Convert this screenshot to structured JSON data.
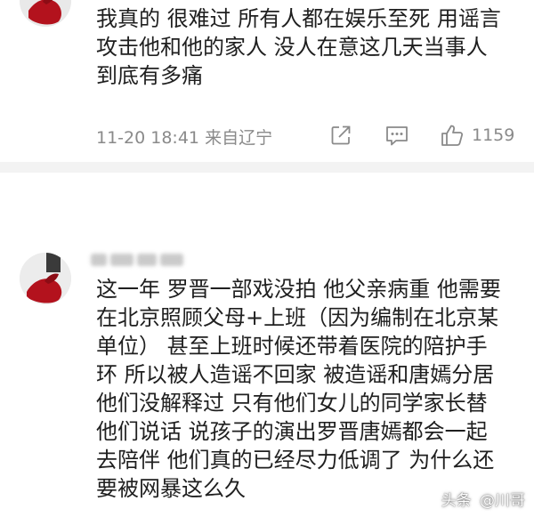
{
  "comments": [
    {
      "lines": [
        "我真的 很难过 所有人都在娱乐至死 用谣言",
        "攻击他和他的家人 没人在意这几天当事人",
        "到底有多痛"
      ],
      "time": "11-20 18:41",
      "location": "来自辽宁",
      "actions": {
        "share_icon": "share-icon",
        "comment_icon": "comment-icon",
        "like_icon": "thumbs-up-icon",
        "like_count": "1159"
      }
    },
    {
      "lines": [
        "这一年 罗晋一部戏没拍 他父亲病重 他需要",
        "在北京照顾父母+上班（因为编制在北京某",
        "单位） 甚至上班时候还带着医院的陪护手",
        "环 所以被人造谣不回家 被造谣和唐嫣分居",
        "他们没解释过 只有他们女儿的同学家长替",
        "他们说话 说孩子的演出罗晋唐嫣都会一起",
        "去陪伴 他们真的已经尽力低调了 为什么还",
        "要被网暴这么久"
      ]
    }
  ],
  "watermark": {
    "platform": "头条",
    "author": "@川哥"
  },
  "colors": {
    "text": "#1f1f1f",
    "meta": "#8a8a8a",
    "divider": "#f3f3f3",
    "avatar_red": "#b3121d"
  }
}
